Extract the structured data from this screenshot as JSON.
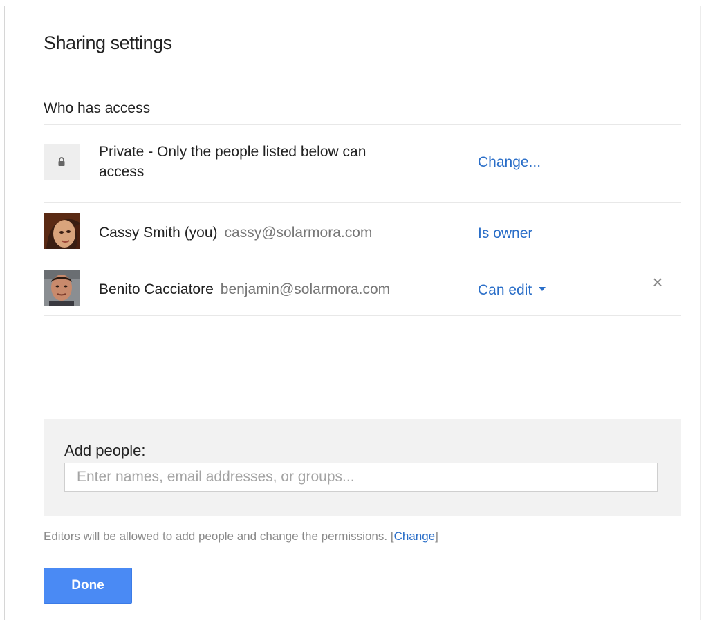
{
  "dialog": {
    "title": "Sharing settings",
    "section_heading": "Who has access"
  },
  "access": {
    "icon": "lock-icon",
    "line1": "Private - Only the people listed below can",
    "line2": "access",
    "change_label": "Change..."
  },
  "people": [
    {
      "name": "Cassy Smith (you)",
      "email": "cassy@solarmora.com",
      "role": "Is owner",
      "avatar": "avatar-photo"
    },
    {
      "name": "Benito Cacciatore",
      "email": "benjamin@solarmora.com",
      "role": "Can edit",
      "role_icon": "caret-down-icon",
      "remove_icon": "close-icon",
      "remove_symbol": "×",
      "avatar": "avatar-photo"
    }
  ],
  "add_people": {
    "label": "Add people:",
    "placeholder": "Enter names, email addresses, or groups...",
    "value": ""
  },
  "note": {
    "text": "Editors will be allowed to add people and change the permissions.",
    "bracket_open": "[",
    "link": "Change",
    "bracket_close": "]"
  },
  "done_label": "Done",
  "colors": {
    "link": "#2a6ec8",
    "primary_button": "#4a8af4",
    "panel_bg": "#f2f2f2"
  }
}
